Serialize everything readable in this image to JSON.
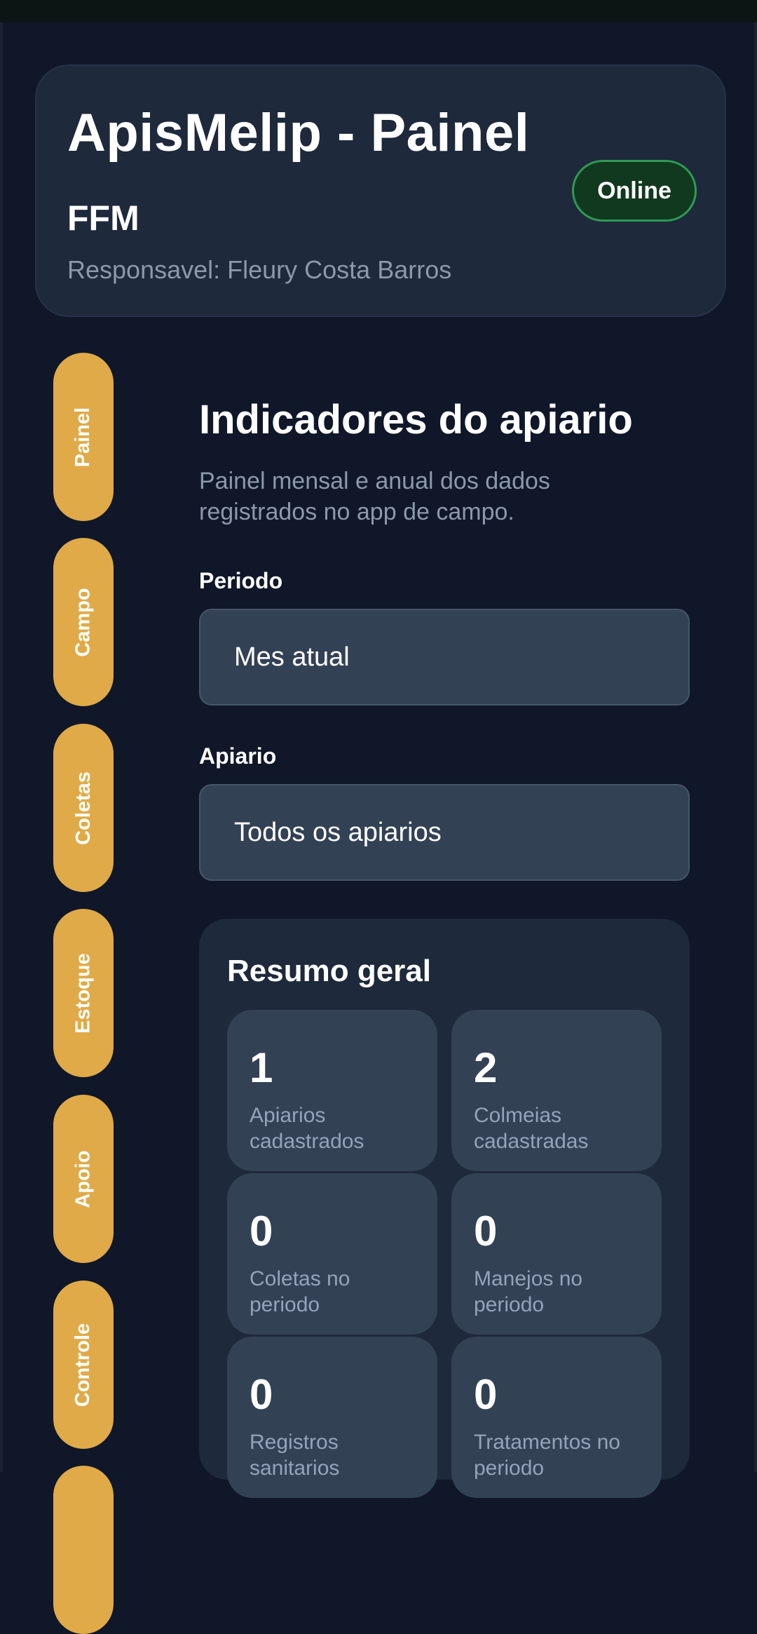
{
  "header": {
    "app_title": "ApisMelip - Painel",
    "org_name": "FFM",
    "responsavel": "Responsavel: Fleury Costa Barros",
    "status": "Online"
  },
  "nav": {
    "tabs": [
      "Painel",
      "Campo",
      "Coletas",
      "Estoque",
      "Apoio",
      "Controle"
    ]
  },
  "main": {
    "title": "Indicadores do apiario",
    "subtitle": "Painel mensal e anual dos dados registrados no app de campo.",
    "period_label": "Periodo",
    "period_value": "Mes atual",
    "apiary_label": "Apiario",
    "apiary_value": "Todos os apiarios"
  },
  "summary": {
    "title": "Resumo geral",
    "stats": [
      {
        "value": "1",
        "label": "Apiarios cadastrados"
      },
      {
        "value": "2",
        "label": "Colmeias cadastradas"
      },
      {
        "value": "0",
        "label": "Coletas no periodo"
      },
      {
        "value": "0",
        "label": "Manejos no periodo"
      },
      {
        "value": "0",
        "label": "Registros sanitarios"
      },
      {
        "value": "0",
        "label": "Tratamentos no periodo"
      }
    ]
  },
  "colors": {
    "background": "#0f1729",
    "card": "#1e293b",
    "input": "#334155",
    "accent": "#e0aa48",
    "online": "#2e9a52"
  }
}
